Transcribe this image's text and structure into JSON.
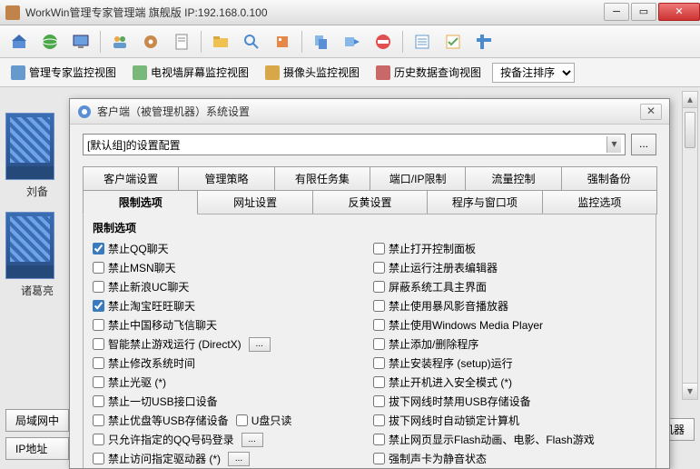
{
  "main": {
    "title": "WorkWin管理专家管理端    旗舰版 IP:192.168.0.100"
  },
  "viewtabs": {
    "v1": "管理专家监控视图",
    "v2": "电视墙屏幕监控视图",
    "v3": "摄像头监控视图",
    "v4": "历史数据查询视图",
    "sort_label": "按备注排序"
  },
  "thumbs": {
    "t1_label": "刘备",
    "t2_label": "诸葛亮"
  },
  "bottom": {
    "b1": "局域网中",
    "b2": "IP地址",
    "right": "监视机器"
  },
  "dialog": {
    "title": "客户端（被管理机器）系统设置",
    "combo_value": "[默认组]的设置配置",
    "browse_label": "...",
    "tabs_row1": {
      "t1": "客户端设置",
      "t2": "管理策略",
      "t3": "有限任务集",
      "t4": "端口/IP限制",
      "t5": "流量控制",
      "t6": "强制备份"
    },
    "tabs_row2": {
      "t1": "限制选项",
      "t2": "网址设置",
      "t3": "反黄设置",
      "t4": "程序与窗口项",
      "t5": "监控选项"
    },
    "group_title": "限制选项",
    "left_checks": [
      {
        "label": "禁止QQ聊天",
        "checked": true
      },
      {
        "label": "禁止MSN聊天",
        "checked": false
      },
      {
        "label": "禁止新浪UC聊天",
        "checked": false
      },
      {
        "label": "禁止淘宝旺旺聊天",
        "checked": true
      },
      {
        "label": "禁止中国移动飞信聊天",
        "checked": false
      },
      {
        "label": "智能禁止游戏运行 (DirectX)",
        "checked": false,
        "extra": "..."
      },
      {
        "label": "禁止修改系统时间",
        "checked": false
      },
      {
        "label": "禁止光驱 (*)",
        "checked": false
      },
      {
        "label": "禁止一切USB接口设备",
        "checked": false
      },
      {
        "label": "禁止优盘等USB存储设备",
        "checked": false,
        "inline": {
          "cb": false,
          "text": "U盘只读"
        }
      },
      {
        "label": "只允许指定的QQ号码登录",
        "checked": false,
        "extra": "..."
      },
      {
        "label": "禁止访问指定驱动器 (*)",
        "checked": false,
        "extra": "..."
      }
    ],
    "right_checks": [
      {
        "label": "禁止打开控制面板",
        "checked": false
      },
      {
        "label": "禁止运行注册表编辑器",
        "checked": false
      },
      {
        "label": "屏蔽系统工具主界面",
        "checked": false
      },
      {
        "label": "禁止使用暴风影音播放器",
        "checked": false
      },
      {
        "label": "禁止使用Windows Media Player",
        "checked": false
      },
      {
        "label": "禁止添加/删除程序",
        "checked": false
      },
      {
        "label": "禁止安装程序 (setup)运行",
        "checked": false
      },
      {
        "label": "禁止开机进入安全模式 (*)",
        "checked": false
      },
      {
        "label": "拔下网线时禁用USB存储设备",
        "checked": false
      },
      {
        "label": "拔下网线时自动锁定计算机",
        "checked": false
      },
      {
        "label": "禁止网页显示Flash动画、电影、Flash游戏",
        "checked": false
      },
      {
        "label": "强制声卡为静音状态",
        "checked": false
      }
    ]
  }
}
